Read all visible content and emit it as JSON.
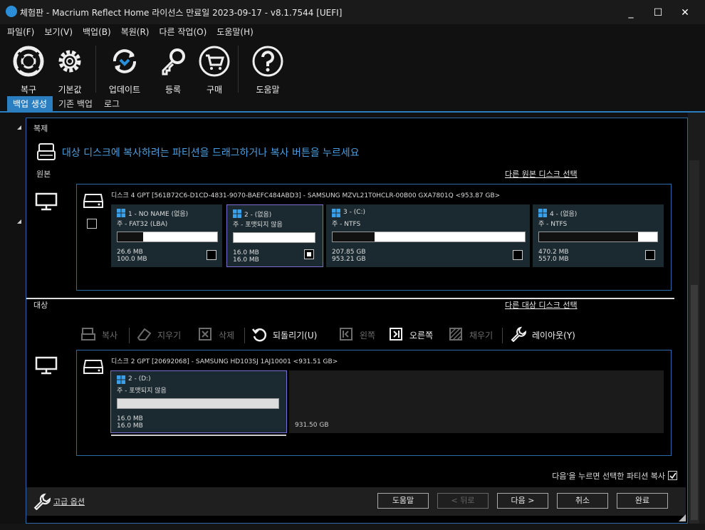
{
  "window": {
    "title": "체험판 - Macrium Reflect Home 라이선스 만료일 2023-09-17 - v8.1.7544  [UEFI]",
    "minimize": "_",
    "maximize": "☐",
    "close": "✕"
  },
  "menu": [
    "파일(F)",
    "보기(V)",
    "백업(B)",
    "복원(R)",
    "다른 작업(O)",
    "도움말(H)"
  ],
  "toolbar": {
    "restore": "복구",
    "defaults": "기본값",
    "update": "업데이트",
    "register": "등록",
    "buy": "구매",
    "help": "도움말"
  },
  "tabs": [
    "백업 생성",
    "기존 백업",
    "로그"
  ],
  "dialog": {
    "heading": "복제",
    "hint": "대상 디스크에 복사하려는 파티션을 드래그하거나 복사 버튼을 누르세요",
    "source_label": "원본",
    "select_source_link": "다른 원본 디스크 선택",
    "target_label": "대상",
    "select_target_link": "다른 대상 디스크 선택",
    "source_disk": {
      "header": "디스크 4 GPT [561B72C6-D1CD-4831-9070-BAEFC484ABD3] - SAMSUNG MZVL21T0HCLR-00B00 GXA7801Q  <953.87 GB>",
      "partitions": [
        {
          "name": "1 - NO NAME (없음)",
          "type": "주 - FAT32 (LBA)",
          "used": "26.6 MB",
          "total": "100.0 MB",
          "fill": 0.26
        },
        {
          "name": "2 -  (없음)",
          "type": "주 - 포맷되지 않음",
          "used": "16.0 MB",
          "total": "16.0 MB",
          "fill": 0.0
        },
        {
          "name": "3 -  (C:)",
          "type": "주 - NTFS",
          "used": "207.85 GB",
          "total": "953.21 GB",
          "fill": 0.22
        },
        {
          "name": "4 -  (없음)",
          "type": "주 - NTFS",
          "used": "470.2 MB",
          "total": "557.0 MB",
          "fill": 0.84
        }
      ]
    },
    "actions": {
      "copy": "복사",
      "erase": "지우기",
      "delete": "삭제",
      "undo": "되돌리기(U)",
      "left": "왼쪽",
      "right": "오른쪽",
      "fill": "채우기",
      "layout": "레이아웃(Y)"
    },
    "target_disk": {
      "header": "디스크 2 GPT [20692068] - SAMSUNG HD103SJ 1AJ10001  <931.51 GB>",
      "partition": {
        "name": "2 -  (D:)",
        "type": "주 - 포맷되지 않음",
        "used": "16.0 MB",
        "total": "16.0 MB",
        "fill": 0.0
      },
      "unallocated": "931.50 GB"
    },
    "copy_checkbox": "다음'을 누르면 선택한 파티션 복사",
    "advanced": "고급 옵션",
    "buttons": {
      "help": "도움말",
      "back": "< 뒤로",
      "next": "다음 >",
      "cancel": "취소",
      "finish": "완료"
    }
  }
}
